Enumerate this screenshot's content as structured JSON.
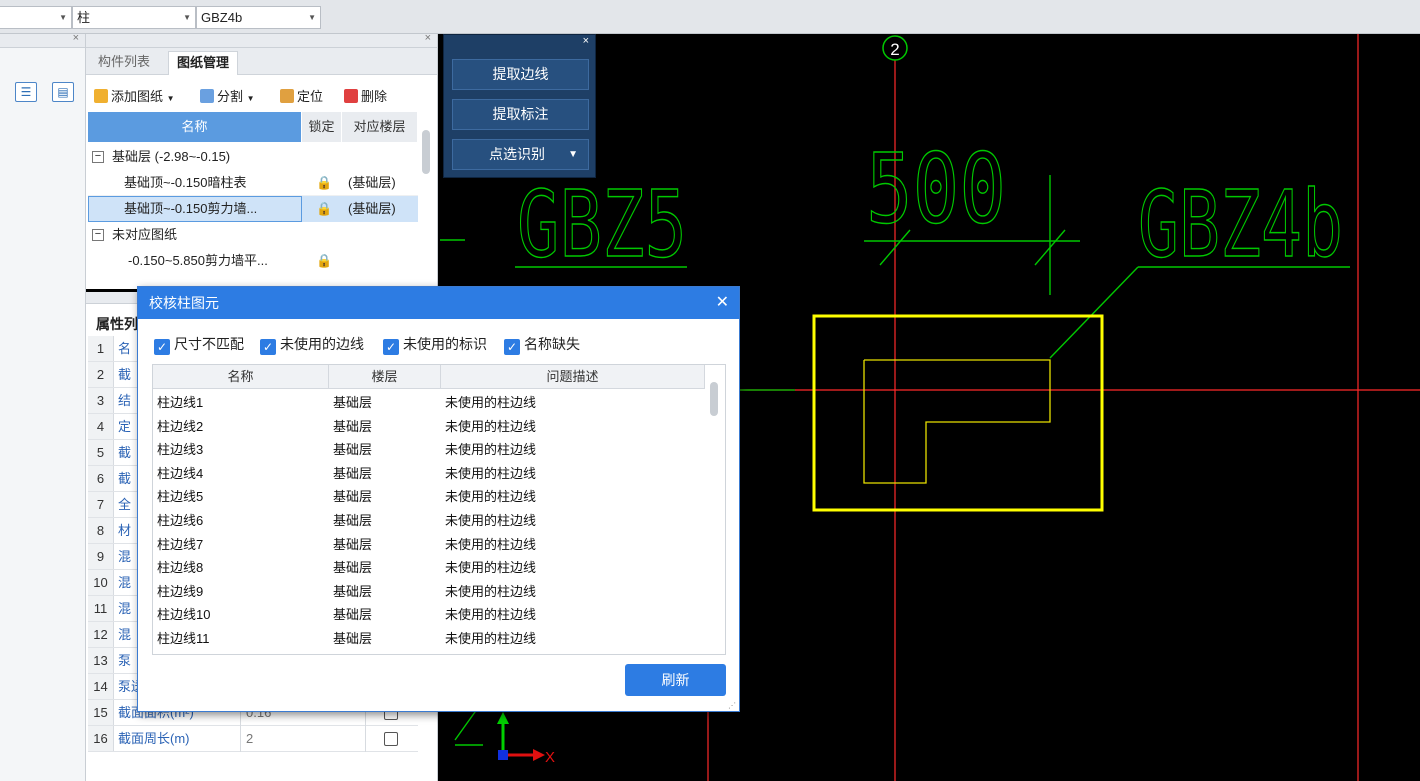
{
  "toolbar": {
    "combo_type": "柱",
    "combo_name": "GBZ4b"
  },
  "drawing_panel": {
    "tabs": [
      "构件列表",
      "图纸管理"
    ],
    "actions": {
      "add": "添加图纸",
      "split": "分割",
      "locate": "定位",
      "delete": "删除"
    },
    "columns": [
      "名称",
      "锁定",
      "对应楼层"
    ],
    "rows": [
      {
        "name": "基础层 (-2.98~-0.15)",
        "floor": "",
        "kind": "group"
      },
      {
        "name": "基础顶~-0.150暗柱表",
        "floor": "(基础层)",
        "kind": "item"
      },
      {
        "name": "基础顶~-0.150剪力墙...",
        "floor": "(基础层)",
        "kind": "item-selected"
      },
      {
        "name": "未对应图纸",
        "floor": "",
        "kind": "group"
      },
      {
        "name": "-0.150~5.850剪力墙平...",
        "floor": "",
        "kind": "item"
      }
    ]
  },
  "extract_panel": {
    "buttons": [
      "提取边线",
      "提取标注",
      "点选识别"
    ]
  },
  "attr_panel": {
    "title": "属性列",
    "rows": [
      {
        "num": "1",
        "name": "名",
        "val": ""
      },
      {
        "num": "2",
        "name": "截",
        "val": ""
      },
      {
        "num": "3",
        "name": "结",
        "val": ""
      },
      {
        "num": "4",
        "name": "定",
        "val": ""
      },
      {
        "num": "5",
        "name": "截",
        "val": ""
      },
      {
        "num": "6",
        "name": "截",
        "val": ""
      },
      {
        "num": "7",
        "name": "全",
        "val": ""
      },
      {
        "num": "8",
        "name": "材",
        "val": ""
      },
      {
        "num": "9",
        "name": "混",
        "val": ""
      },
      {
        "num": "10",
        "name": "混",
        "val": ""
      },
      {
        "num": "11",
        "name": "混",
        "val": ""
      },
      {
        "num": "12",
        "name": "混",
        "val": ""
      },
      {
        "num": "13",
        "name": "泵",
        "val": ""
      },
      {
        "num": "14",
        "name": "泵送高度(m)",
        "val": ""
      },
      {
        "num": "15",
        "name": "截面面积(m²)",
        "val": "0.16"
      },
      {
        "num": "16",
        "name": "截面周长(m)",
        "val": "2"
      }
    ]
  },
  "dialog": {
    "title": "校核柱图元",
    "filters": [
      "尺寸不匹配",
      "未使用的边线",
      "未使用的标识",
      "名称缺失"
    ],
    "columns": [
      "名称",
      "楼层",
      "问题描述"
    ],
    "rows": [
      [
        "柱边线1",
        "基础层",
        "未使用的柱边线"
      ],
      [
        "柱边线2",
        "基础层",
        "未使用的柱边线"
      ],
      [
        "柱边线3",
        "基础层",
        "未使用的柱边线"
      ],
      [
        "柱边线4",
        "基础层",
        "未使用的柱边线"
      ],
      [
        "柱边线5",
        "基础层",
        "未使用的柱边线"
      ],
      [
        "柱边线6",
        "基础层",
        "未使用的柱边线"
      ],
      [
        "柱边线7",
        "基础层",
        "未使用的柱边线"
      ],
      [
        "柱边线8",
        "基础层",
        "未使用的柱边线"
      ],
      [
        "柱边线9",
        "基础层",
        "未使用的柱边线"
      ],
      [
        "柱边线10",
        "基础层",
        "未使用的柱边线"
      ],
      [
        "柱边线11",
        "基础层",
        "未使用的柱边线"
      ]
    ],
    "refresh": "刷新"
  },
  "cad": {
    "axis_label": "2",
    "labels": [
      "GBZ5",
      "500",
      "GBZ4b"
    ],
    "axis_x": "X",
    "colors": {
      "background": "#000000",
      "axis_line": "#ff2a2a",
      "dimension": "#00c800",
      "column": "#ffff00"
    }
  }
}
